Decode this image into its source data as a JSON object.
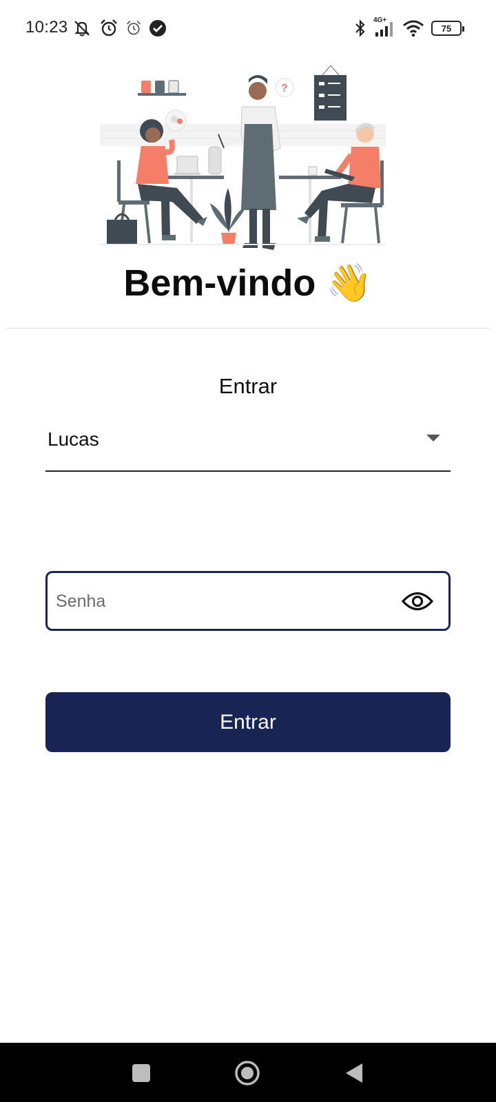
{
  "status_bar": {
    "time": "10:23",
    "network": "4G+",
    "battery": "75"
  },
  "welcome": {
    "title": "Bem-vindo",
    "emoji": "👋"
  },
  "login": {
    "heading": "Entrar",
    "user_select": {
      "value": "Lucas"
    },
    "password": {
      "placeholder": "Senha"
    },
    "submit_label": "Entrar"
  },
  "colors": {
    "primary": "#182454",
    "border": "#1a2452",
    "accent": "#f47e67"
  },
  "icons": [
    "mute-icon",
    "alarm-icon",
    "alarm-outline-icon",
    "check-circle-icon",
    "bluetooth-icon",
    "signal-icon",
    "wifi-icon",
    "battery-icon",
    "dropdown-arrow-icon",
    "eye-icon",
    "recents-icon",
    "home-icon",
    "back-icon"
  ]
}
